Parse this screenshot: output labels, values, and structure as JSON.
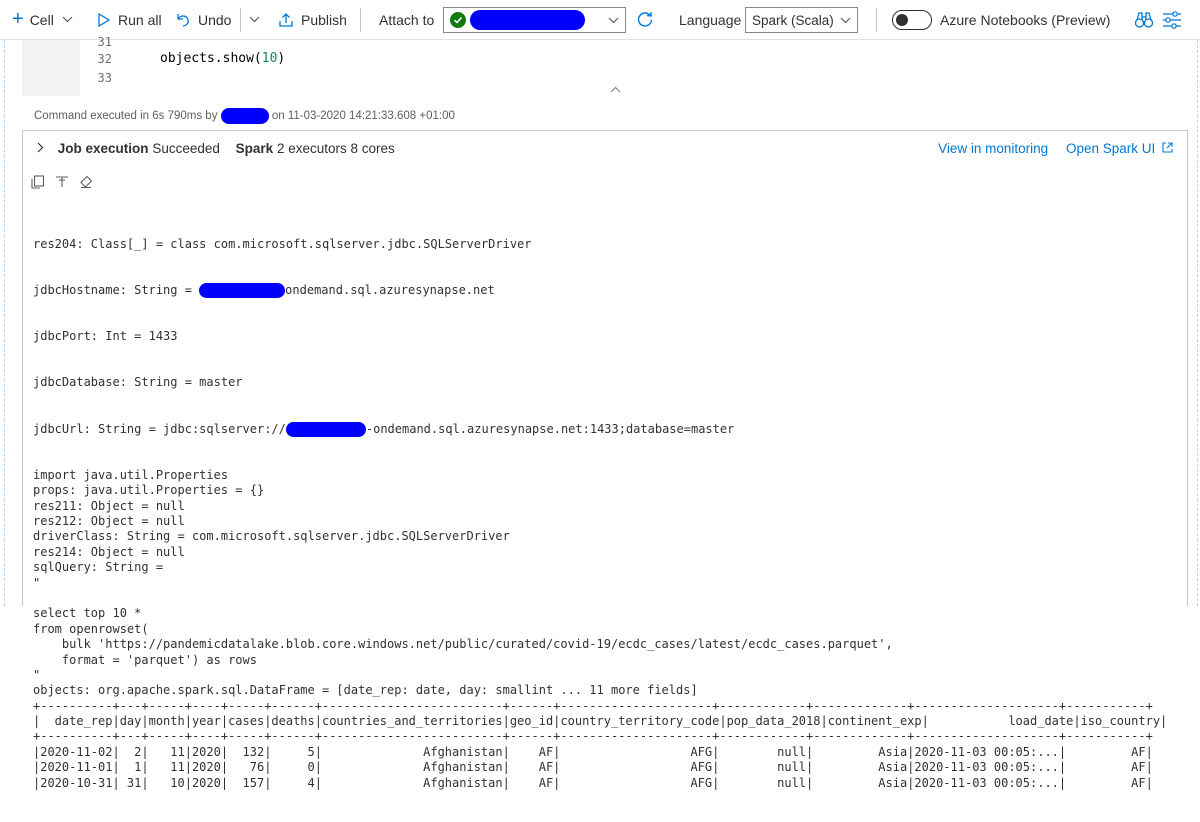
{
  "toolbar": {
    "cell_label": "Cell",
    "run_all_label": "Run all",
    "undo_label": "Undo",
    "publish_label": "Publish",
    "attach_label": "Attach to",
    "language_label": "Language",
    "language_value": "Spark (Scala)",
    "notebooks_label": "Azure Notebooks (Preview)"
  },
  "editor": {
    "lines": [
      {
        "num": "31",
        "text": ""
      },
      {
        "num": "32",
        "text": "objects.show(",
        "arg": "10",
        "close": ")"
      },
      {
        "num": "33",
        "text": ""
      }
    ]
  },
  "status": {
    "prefix": "Command executed in 6s 790ms by",
    "suffix": "on 11-03-2020 14:21:33.608 +01:00"
  },
  "job": {
    "title": "Job execution",
    "state": "Succeeded",
    "spark_label": "Spark",
    "spark_info": "2 executors 8 cores",
    "view_monitoring": "View in monitoring",
    "open_spark_ui": "Open Spark UI"
  },
  "output": {
    "res204": "res204: Class[_] = class com.microsoft.sqlserver.jdbc.SQLServerDriver",
    "host_prefix": "jdbcHostname: String = ",
    "host_suffix": "ondemand.sql.azuresynapse.net",
    "port": "jdbcPort: Int = 1433",
    "database": "jdbcDatabase: String = master",
    "url_prefix": "jdbcUrl: String = jdbc:sqlserver://",
    "url_suffix": "-ondemand.sql.azuresynapse.net:1433;database=master",
    "rest": [
      "import java.util.Properties",
      "props: java.util.Properties = {}",
      "res211: Object = null",
      "res212: Object = null",
      "driverClass: String = com.microsoft.sqlserver.jdbc.SQLServerDriver",
      "res214: Object = null",
      "sqlQuery: String =",
      "\"",
      "",
      "select top 10 *",
      "from openrowset(",
      "    bulk 'https://pandemicdatalake.blob.core.windows.net/public/curated/covid-19/ecdc_cases/latest/ecdc_cases.parquet',",
      "    format = 'parquet') as rows",
      "\"",
      "objects: org.apache.spark.sql.DataFrame = [date_rep: date, day: smallint ... 11 more fields]",
      "+----------+---+-----+----+-----+------+-------------------------+------+---------------------+------------+-------------+--------------------+-----------+",
      "|  date_rep|day|month|year|cases|deaths|countries_and_territories|geo_id|country_territory_code|pop_data_2018|continent_exp|           load_date|iso_country|",
      "+----------+---+-----+----+-----+------+-------------------------+------+---------------------+------------+-------------+--------------------+-----------+",
      "|2020-11-02|  2|   11|2020|  132|     5|              Afghanistan|    AF|                  AFG|        null|         Asia|2020-11-03 00:05:...|         AF|",
      "|2020-11-01|  1|   11|2020|   76|     0|              Afghanistan|    AF|                  AFG|        null|         Asia|2020-11-03 00:05:...|         AF|",
      "|2020-10-31| 31|   10|2020|  157|     4|              Afghanistan|    AF|                  AFG|        null|         Asia|2020-11-03 00:05:...|         AF|"
    ]
  }
}
